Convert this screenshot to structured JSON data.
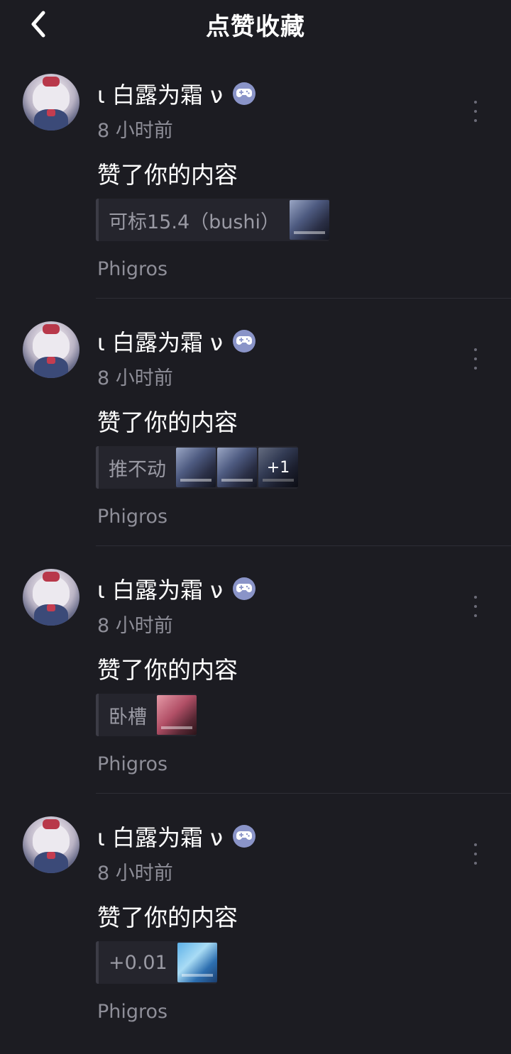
{
  "header": {
    "title": "点赞收藏",
    "back_icon": "chevron-left-icon"
  },
  "items": [
    {
      "username": "ι 白露为霜 ν",
      "badge_icon": "gamepad-icon",
      "time": "8 小时前",
      "action": "赞了你的内容",
      "quote": "可标15.4（bushi）",
      "thumbs": [
        "blue"
      ],
      "extra_count": "",
      "source": "Phigros"
    },
    {
      "username": "ι 白露为霜 ν",
      "badge_icon": "gamepad-icon",
      "time": "8 小时前",
      "action": "赞了你的内容",
      "quote": "推不动",
      "thumbs": [
        "blue",
        "blue",
        "blue"
      ],
      "extra_count": "+1",
      "source": "Phigros"
    },
    {
      "username": "ι 白露为霜 ν",
      "badge_icon": "gamepad-icon",
      "time": "8 小时前",
      "action": "赞了你的内容",
      "quote": "卧槽",
      "thumbs": [
        "pink"
      ],
      "extra_count": "",
      "source": "Phigros"
    },
    {
      "username": "ι 白露为霜 ν",
      "badge_icon": "gamepad-icon",
      "time": "8 小时前",
      "action": "赞了你的内容",
      "quote": "+0.01",
      "thumbs": [
        "sky"
      ],
      "extra_count": "",
      "source": "Phigros"
    }
  ],
  "colors": {
    "background": "#1c1c22",
    "badge": "#8a94c8",
    "secondary_text": "#8e8e98"
  }
}
